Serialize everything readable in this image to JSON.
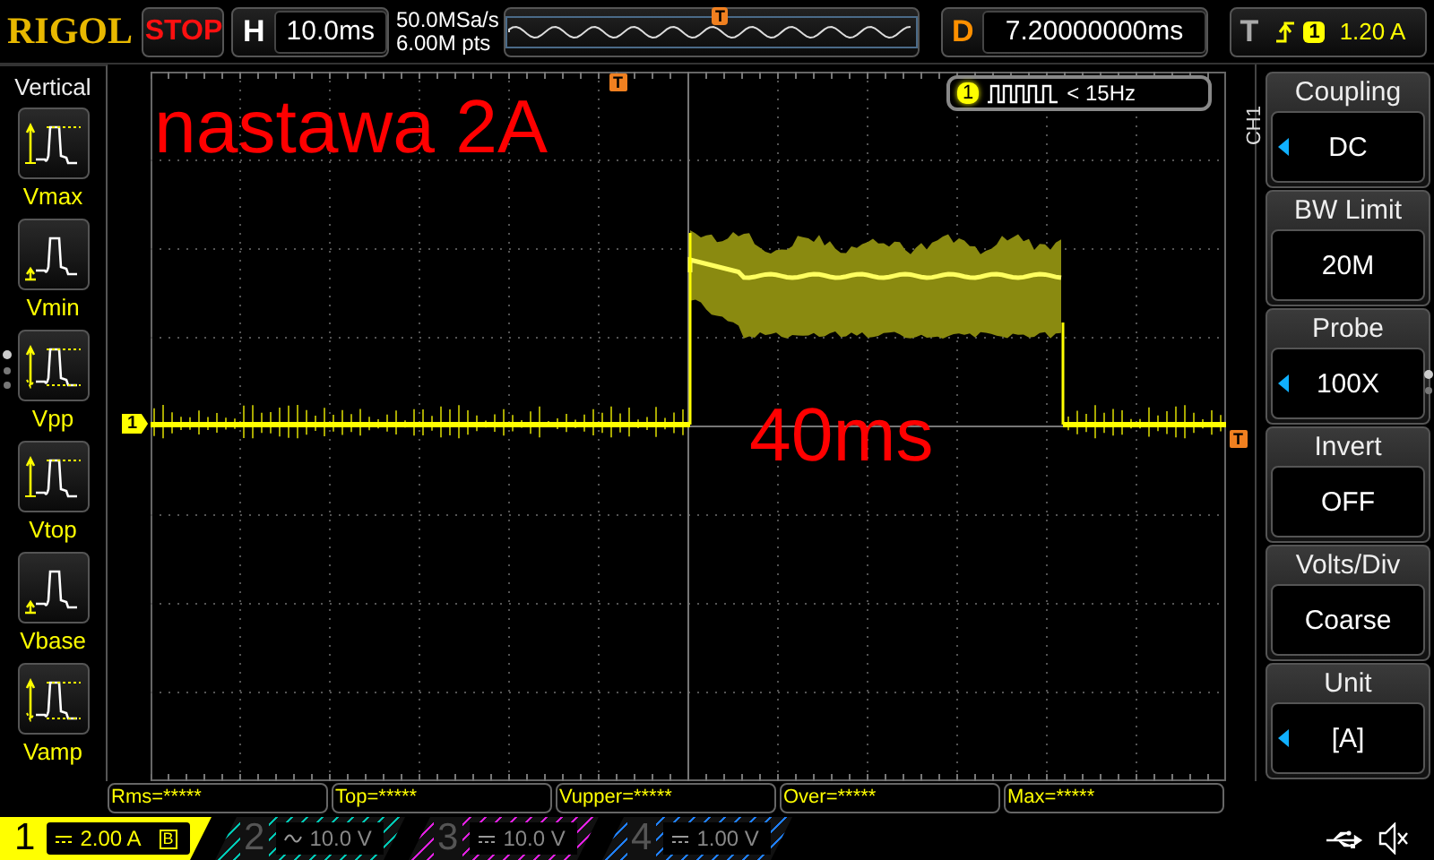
{
  "top_bar": {
    "logo": "RIGOL",
    "run_state": "STOP",
    "horizontal": {
      "label": "H",
      "value": "10.0ms"
    },
    "sample_rate": "50.0MSa/s",
    "memory_depth": "6.00M pts",
    "memory_marker": "T",
    "delay": {
      "label": "D",
      "value": "7.20000000ms"
    },
    "trigger": {
      "label": "T",
      "kind": "rising",
      "source": "1",
      "level": "1.20 A"
    }
  },
  "vertical_menu": {
    "title": "Vertical",
    "items": [
      {
        "label": "Vmax"
      },
      {
        "label": "Vmin"
      },
      {
        "label": "Vpp"
      },
      {
        "label": "Vtop"
      },
      {
        "label": "Vbase"
      },
      {
        "label": "Vamp"
      }
    ]
  },
  "screen": {
    "annotation_title": "nastawa 2A",
    "annotation_pulse": "40ms",
    "channel_marker": "1",
    "trigger_position_marker": "T",
    "trigger_level_marker": "T",
    "counter": {
      "channel": "1",
      "value": "< 15Hz"
    }
  },
  "channel_menu": {
    "label": "CH1",
    "items": [
      {
        "title": "Coupling",
        "value": "DC",
        "arrow": true
      },
      {
        "title": "BW Limit",
        "value": "20M",
        "arrow": false
      },
      {
        "title": "Probe",
        "value": "100X",
        "arrow": true
      },
      {
        "title": "Invert",
        "value": "OFF",
        "arrow": false
      },
      {
        "title": "Volts/Div",
        "value": "Coarse",
        "arrow": false
      },
      {
        "title": "Unit",
        "value": "[A]",
        "arrow": true
      }
    ]
  },
  "measurements": [
    "Rms=*****",
    "Top=*****",
    "Vupper=*****",
    "Over=*****",
    "Max=*****"
  ],
  "channels": [
    {
      "number": "1",
      "kind": "dc",
      "scale": "2.00 A",
      "bw_mark": "B",
      "active": true,
      "color": "#ffff00"
    },
    {
      "number": "2",
      "kind": "ac",
      "scale": "10.0 V",
      "active": false,
      "color": "#00c8b4"
    },
    {
      "number": "3",
      "kind": "dc",
      "scale": "10.0 V",
      "active": false,
      "color": "#e020e0"
    },
    {
      "number": "4",
      "kind": "dc",
      "scale": "1.00 V",
      "active": false,
      "color": "#2080ff"
    }
  ]
}
